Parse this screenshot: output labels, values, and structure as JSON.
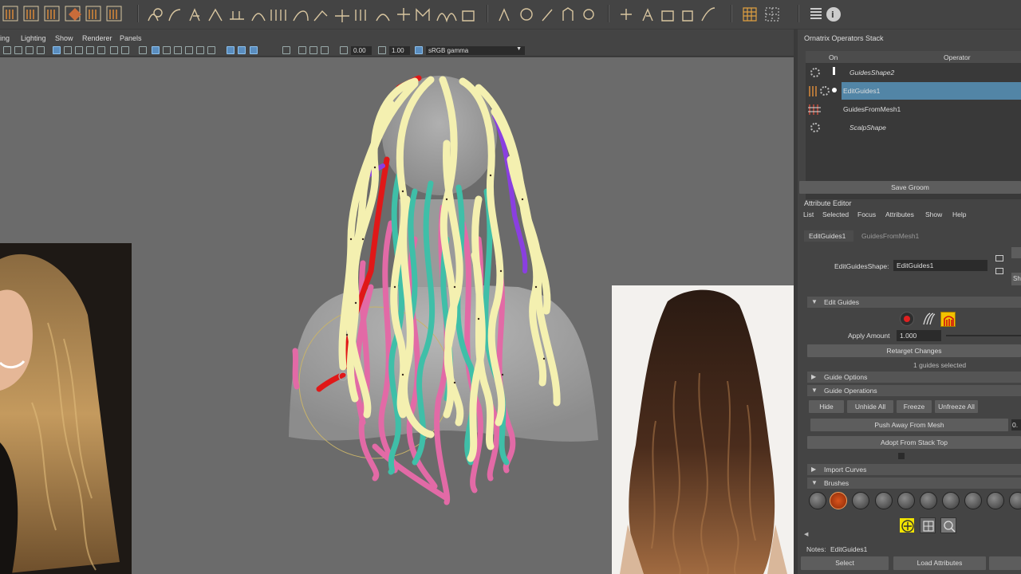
{
  "menubar": {
    "items": [
      "ing",
      "Lighting",
      "Show",
      "Renderer",
      "Panels"
    ]
  },
  "viewport_toolbar": {
    "value1": "0.00",
    "value2": "1.00",
    "colorspace": "sRGB gamma"
  },
  "ops_stack": {
    "title": "Ornatrix Operators Stack",
    "col_on": "On",
    "col_operator": "Operator",
    "rows": [
      {
        "name": "GuidesShape2",
        "italic": true,
        "selected": false
      },
      {
        "name": "EditGuides1",
        "italic": false,
        "selected": true
      },
      {
        "name": "GuidesFromMesh1",
        "italic": false,
        "selected": false
      },
      {
        "name": "ScalpShape",
        "italic": true,
        "selected": false
      }
    ],
    "save_groom": "Save Groom"
  },
  "attr_editor": {
    "title": "Attribute Editor",
    "menu": [
      "List",
      "Selected",
      "Focus",
      "Attributes",
      "Show",
      "Help"
    ],
    "tabs": [
      "EditGuides1",
      "GuidesFromMesh1"
    ],
    "shape_label": "EditGuidesShape:",
    "shape_value": "EditGuides1",
    "side_label": "Sh",
    "edit_guides": "Edit Guides",
    "apply_amount_label": "Apply Amount",
    "apply_amount_value": "1.000",
    "retarget_changes": "Retarget Changes",
    "guides_selected": "1 guides selected",
    "guide_options": "Guide Options",
    "guide_operations": "Guide Operations",
    "ops_buttons": [
      "Hide",
      "Unhide All",
      "Freeze",
      "Unfreeze All"
    ],
    "push_away": "Push Away From Mesh",
    "push_value": "0.",
    "adopt": "Adopt From Stack Top",
    "import_curves": "Import Curves",
    "brushes": "Brushes",
    "notes_label": "Notes:",
    "notes_value": "EditGuides1",
    "select": "Select",
    "load_attributes": "Load Attributes"
  },
  "colors": {
    "guide_yellow": "#f4f0b0",
    "guide_pink": "#e26aa6",
    "guide_teal": "#3fbfa8",
    "guide_red": "#e01818",
    "guide_purple": "#8a3fe0",
    "selection_blue": "#5285a6"
  }
}
